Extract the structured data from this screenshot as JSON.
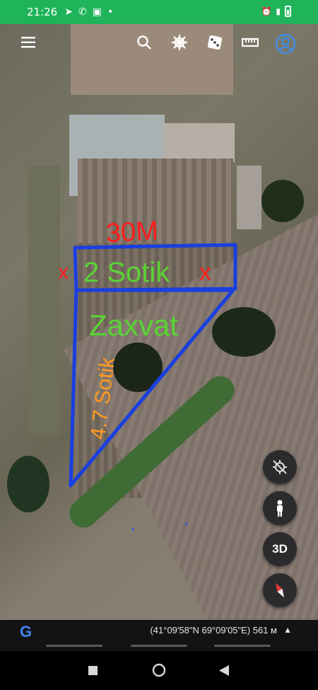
{
  "status_bar": {
    "time": "21:26",
    "icons": [
      "telegram-icon",
      "phone-icon",
      "image-icon",
      "dot-icon",
      "alarm-icon",
      "signal-icon",
      "battery-icon"
    ]
  },
  "toolbar": {
    "icons": [
      "menu-icon",
      "search-icon",
      "voyager-wheel-icon",
      "dice-icon",
      "ruler-icon",
      "account-icon"
    ]
  },
  "annotations": {
    "width_label": "30M",
    "plot_label": "2 Sotik",
    "mark_left": "x",
    "mark_right": "x",
    "zaxvat_label": "Zaxvat",
    "side_label": "4.7 Sotik"
  },
  "controls": {
    "three_d_label": "3D"
  },
  "bottom_bar": {
    "logo": "G",
    "coordinates": "(41°09'58\"N 69°09'05\"E) 561 м",
    "caret": "▲"
  },
  "colors": {
    "status_green": "#1fb35a",
    "annotation_blue": "#1a3fe0",
    "annotation_green": "#5ad335",
    "annotation_red": "#ff1d1d",
    "annotation_orange": "#ff9a1f"
  }
}
